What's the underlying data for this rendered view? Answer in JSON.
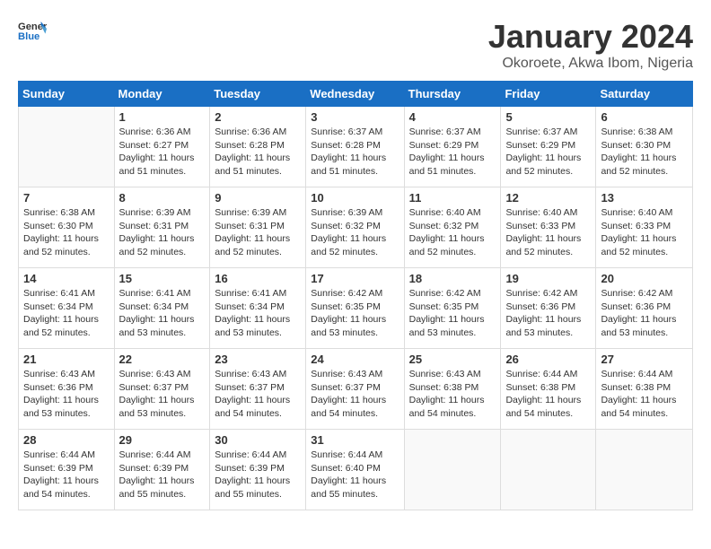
{
  "header": {
    "logo_line1": "General",
    "logo_line2": "Blue",
    "month_title": "January 2024",
    "location": "Okoroete, Akwa Ibom, Nigeria"
  },
  "weekdays": [
    "Sunday",
    "Monday",
    "Tuesday",
    "Wednesday",
    "Thursday",
    "Friday",
    "Saturday"
  ],
  "weeks": [
    [
      {
        "day": "",
        "sunrise": "",
        "sunset": "",
        "daylight": ""
      },
      {
        "day": "1",
        "sunrise": "Sunrise: 6:36 AM",
        "sunset": "Sunset: 6:27 PM",
        "daylight": "Daylight: 11 hours and 51 minutes."
      },
      {
        "day": "2",
        "sunrise": "Sunrise: 6:36 AM",
        "sunset": "Sunset: 6:28 PM",
        "daylight": "Daylight: 11 hours and 51 minutes."
      },
      {
        "day": "3",
        "sunrise": "Sunrise: 6:37 AM",
        "sunset": "Sunset: 6:28 PM",
        "daylight": "Daylight: 11 hours and 51 minutes."
      },
      {
        "day": "4",
        "sunrise": "Sunrise: 6:37 AM",
        "sunset": "Sunset: 6:29 PM",
        "daylight": "Daylight: 11 hours and 51 minutes."
      },
      {
        "day": "5",
        "sunrise": "Sunrise: 6:37 AM",
        "sunset": "Sunset: 6:29 PM",
        "daylight": "Daylight: 11 hours and 52 minutes."
      },
      {
        "day": "6",
        "sunrise": "Sunrise: 6:38 AM",
        "sunset": "Sunset: 6:30 PM",
        "daylight": "Daylight: 11 hours and 52 minutes."
      }
    ],
    [
      {
        "day": "7",
        "sunrise": "Sunrise: 6:38 AM",
        "sunset": "Sunset: 6:30 PM",
        "daylight": "Daylight: 11 hours and 52 minutes."
      },
      {
        "day": "8",
        "sunrise": "Sunrise: 6:39 AM",
        "sunset": "Sunset: 6:31 PM",
        "daylight": "Daylight: 11 hours and 52 minutes."
      },
      {
        "day": "9",
        "sunrise": "Sunrise: 6:39 AM",
        "sunset": "Sunset: 6:31 PM",
        "daylight": "Daylight: 11 hours and 52 minutes."
      },
      {
        "day": "10",
        "sunrise": "Sunrise: 6:39 AM",
        "sunset": "Sunset: 6:32 PM",
        "daylight": "Daylight: 11 hours and 52 minutes."
      },
      {
        "day": "11",
        "sunrise": "Sunrise: 6:40 AM",
        "sunset": "Sunset: 6:32 PM",
        "daylight": "Daylight: 11 hours and 52 minutes."
      },
      {
        "day": "12",
        "sunrise": "Sunrise: 6:40 AM",
        "sunset": "Sunset: 6:33 PM",
        "daylight": "Daylight: 11 hours and 52 minutes."
      },
      {
        "day": "13",
        "sunrise": "Sunrise: 6:40 AM",
        "sunset": "Sunset: 6:33 PM",
        "daylight": "Daylight: 11 hours and 52 minutes."
      }
    ],
    [
      {
        "day": "14",
        "sunrise": "Sunrise: 6:41 AM",
        "sunset": "Sunset: 6:34 PM",
        "daylight": "Daylight: 11 hours and 52 minutes."
      },
      {
        "day": "15",
        "sunrise": "Sunrise: 6:41 AM",
        "sunset": "Sunset: 6:34 PM",
        "daylight": "Daylight: 11 hours and 53 minutes."
      },
      {
        "day": "16",
        "sunrise": "Sunrise: 6:41 AM",
        "sunset": "Sunset: 6:34 PM",
        "daylight": "Daylight: 11 hours and 53 minutes."
      },
      {
        "day": "17",
        "sunrise": "Sunrise: 6:42 AM",
        "sunset": "Sunset: 6:35 PM",
        "daylight": "Daylight: 11 hours and 53 minutes."
      },
      {
        "day": "18",
        "sunrise": "Sunrise: 6:42 AM",
        "sunset": "Sunset: 6:35 PM",
        "daylight": "Daylight: 11 hours and 53 minutes."
      },
      {
        "day": "19",
        "sunrise": "Sunrise: 6:42 AM",
        "sunset": "Sunset: 6:36 PM",
        "daylight": "Daylight: 11 hours and 53 minutes."
      },
      {
        "day": "20",
        "sunrise": "Sunrise: 6:42 AM",
        "sunset": "Sunset: 6:36 PM",
        "daylight": "Daylight: 11 hours and 53 minutes."
      }
    ],
    [
      {
        "day": "21",
        "sunrise": "Sunrise: 6:43 AM",
        "sunset": "Sunset: 6:36 PM",
        "daylight": "Daylight: 11 hours and 53 minutes."
      },
      {
        "day": "22",
        "sunrise": "Sunrise: 6:43 AM",
        "sunset": "Sunset: 6:37 PM",
        "daylight": "Daylight: 11 hours and 53 minutes."
      },
      {
        "day": "23",
        "sunrise": "Sunrise: 6:43 AM",
        "sunset": "Sunset: 6:37 PM",
        "daylight": "Daylight: 11 hours and 54 minutes."
      },
      {
        "day": "24",
        "sunrise": "Sunrise: 6:43 AM",
        "sunset": "Sunset: 6:37 PM",
        "daylight": "Daylight: 11 hours and 54 minutes."
      },
      {
        "day": "25",
        "sunrise": "Sunrise: 6:43 AM",
        "sunset": "Sunset: 6:38 PM",
        "daylight": "Daylight: 11 hours and 54 minutes."
      },
      {
        "day": "26",
        "sunrise": "Sunrise: 6:44 AM",
        "sunset": "Sunset: 6:38 PM",
        "daylight": "Daylight: 11 hours and 54 minutes."
      },
      {
        "day": "27",
        "sunrise": "Sunrise: 6:44 AM",
        "sunset": "Sunset: 6:38 PM",
        "daylight": "Daylight: 11 hours and 54 minutes."
      }
    ],
    [
      {
        "day": "28",
        "sunrise": "Sunrise: 6:44 AM",
        "sunset": "Sunset: 6:39 PM",
        "daylight": "Daylight: 11 hours and 54 minutes."
      },
      {
        "day": "29",
        "sunrise": "Sunrise: 6:44 AM",
        "sunset": "Sunset: 6:39 PM",
        "daylight": "Daylight: 11 hours and 55 minutes."
      },
      {
        "day": "30",
        "sunrise": "Sunrise: 6:44 AM",
        "sunset": "Sunset: 6:39 PM",
        "daylight": "Daylight: 11 hours and 55 minutes."
      },
      {
        "day": "31",
        "sunrise": "Sunrise: 6:44 AM",
        "sunset": "Sunset: 6:40 PM",
        "daylight": "Daylight: 11 hours and 55 minutes."
      },
      {
        "day": "",
        "sunrise": "",
        "sunset": "",
        "daylight": ""
      },
      {
        "day": "",
        "sunrise": "",
        "sunset": "",
        "daylight": ""
      },
      {
        "day": "",
        "sunrise": "",
        "sunset": "",
        "daylight": ""
      }
    ]
  ]
}
